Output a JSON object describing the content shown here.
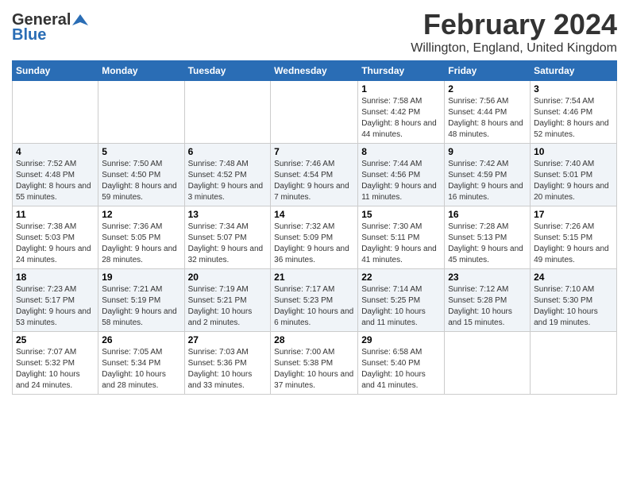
{
  "header": {
    "logo_general": "General",
    "logo_blue": "Blue",
    "month_year": "February 2024",
    "location": "Willington, England, United Kingdom"
  },
  "days_of_week": [
    "Sunday",
    "Monday",
    "Tuesday",
    "Wednesday",
    "Thursday",
    "Friday",
    "Saturday"
  ],
  "weeks": [
    [
      {
        "day": "",
        "sunrise": "",
        "sunset": "",
        "daylight": ""
      },
      {
        "day": "",
        "sunrise": "",
        "sunset": "",
        "daylight": ""
      },
      {
        "day": "",
        "sunrise": "",
        "sunset": "",
        "daylight": ""
      },
      {
        "day": "",
        "sunrise": "",
        "sunset": "",
        "daylight": ""
      },
      {
        "day": "1",
        "sunrise": "Sunrise: 7:58 AM",
        "sunset": "Sunset: 4:42 PM",
        "daylight": "Daylight: 8 hours and 44 minutes."
      },
      {
        "day": "2",
        "sunrise": "Sunrise: 7:56 AM",
        "sunset": "Sunset: 4:44 PM",
        "daylight": "Daylight: 8 hours and 48 minutes."
      },
      {
        "day": "3",
        "sunrise": "Sunrise: 7:54 AM",
        "sunset": "Sunset: 4:46 PM",
        "daylight": "Daylight: 8 hours and 52 minutes."
      }
    ],
    [
      {
        "day": "4",
        "sunrise": "Sunrise: 7:52 AM",
        "sunset": "Sunset: 4:48 PM",
        "daylight": "Daylight: 8 hours and 55 minutes."
      },
      {
        "day": "5",
        "sunrise": "Sunrise: 7:50 AM",
        "sunset": "Sunset: 4:50 PM",
        "daylight": "Daylight: 8 hours and 59 minutes."
      },
      {
        "day": "6",
        "sunrise": "Sunrise: 7:48 AM",
        "sunset": "Sunset: 4:52 PM",
        "daylight": "Daylight: 9 hours and 3 minutes."
      },
      {
        "day": "7",
        "sunrise": "Sunrise: 7:46 AM",
        "sunset": "Sunset: 4:54 PM",
        "daylight": "Daylight: 9 hours and 7 minutes."
      },
      {
        "day": "8",
        "sunrise": "Sunrise: 7:44 AM",
        "sunset": "Sunset: 4:56 PM",
        "daylight": "Daylight: 9 hours and 11 minutes."
      },
      {
        "day": "9",
        "sunrise": "Sunrise: 7:42 AM",
        "sunset": "Sunset: 4:59 PM",
        "daylight": "Daylight: 9 hours and 16 minutes."
      },
      {
        "day": "10",
        "sunrise": "Sunrise: 7:40 AM",
        "sunset": "Sunset: 5:01 PM",
        "daylight": "Daylight: 9 hours and 20 minutes."
      }
    ],
    [
      {
        "day": "11",
        "sunrise": "Sunrise: 7:38 AM",
        "sunset": "Sunset: 5:03 PM",
        "daylight": "Daylight: 9 hours and 24 minutes."
      },
      {
        "day": "12",
        "sunrise": "Sunrise: 7:36 AM",
        "sunset": "Sunset: 5:05 PM",
        "daylight": "Daylight: 9 hours and 28 minutes."
      },
      {
        "day": "13",
        "sunrise": "Sunrise: 7:34 AM",
        "sunset": "Sunset: 5:07 PM",
        "daylight": "Daylight: 9 hours and 32 minutes."
      },
      {
        "day": "14",
        "sunrise": "Sunrise: 7:32 AM",
        "sunset": "Sunset: 5:09 PM",
        "daylight": "Daylight: 9 hours and 36 minutes."
      },
      {
        "day": "15",
        "sunrise": "Sunrise: 7:30 AM",
        "sunset": "Sunset: 5:11 PM",
        "daylight": "Daylight: 9 hours and 41 minutes."
      },
      {
        "day": "16",
        "sunrise": "Sunrise: 7:28 AM",
        "sunset": "Sunset: 5:13 PM",
        "daylight": "Daylight: 9 hours and 45 minutes."
      },
      {
        "day": "17",
        "sunrise": "Sunrise: 7:26 AM",
        "sunset": "Sunset: 5:15 PM",
        "daylight": "Daylight: 9 hours and 49 minutes."
      }
    ],
    [
      {
        "day": "18",
        "sunrise": "Sunrise: 7:23 AM",
        "sunset": "Sunset: 5:17 PM",
        "daylight": "Daylight: 9 hours and 53 minutes."
      },
      {
        "day": "19",
        "sunrise": "Sunrise: 7:21 AM",
        "sunset": "Sunset: 5:19 PM",
        "daylight": "Daylight: 9 hours and 58 minutes."
      },
      {
        "day": "20",
        "sunrise": "Sunrise: 7:19 AM",
        "sunset": "Sunset: 5:21 PM",
        "daylight": "Daylight: 10 hours and 2 minutes."
      },
      {
        "day": "21",
        "sunrise": "Sunrise: 7:17 AM",
        "sunset": "Sunset: 5:23 PM",
        "daylight": "Daylight: 10 hours and 6 minutes."
      },
      {
        "day": "22",
        "sunrise": "Sunrise: 7:14 AM",
        "sunset": "Sunset: 5:25 PM",
        "daylight": "Daylight: 10 hours and 11 minutes."
      },
      {
        "day": "23",
        "sunrise": "Sunrise: 7:12 AM",
        "sunset": "Sunset: 5:28 PM",
        "daylight": "Daylight: 10 hours and 15 minutes."
      },
      {
        "day": "24",
        "sunrise": "Sunrise: 7:10 AM",
        "sunset": "Sunset: 5:30 PM",
        "daylight": "Daylight: 10 hours and 19 minutes."
      }
    ],
    [
      {
        "day": "25",
        "sunrise": "Sunrise: 7:07 AM",
        "sunset": "Sunset: 5:32 PM",
        "daylight": "Daylight: 10 hours and 24 minutes."
      },
      {
        "day": "26",
        "sunrise": "Sunrise: 7:05 AM",
        "sunset": "Sunset: 5:34 PM",
        "daylight": "Daylight: 10 hours and 28 minutes."
      },
      {
        "day": "27",
        "sunrise": "Sunrise: 7:03 AM",
        "sunset": "Sunset: 5:36 PM",
        "daylight": "Daylight: 10 hours and 33 minutes."
      },
      {
        "day": "28",
        "sunrise": "Sunrise: 7:00 AM",
        "sunset": "Sunset: 5:38 PM",
        "daylight": "Daylight: 10 hours and 37 minutes."
      },
      {
        "day": "29",
        "sunrise": "Sunrise: 6:58 AM",
        "sunset": "Sunset: 5:40 PM",
        "daylight": "Daylight: 10 hours and 41 minutes."
      },
      {
        "day": "",
        "sunrise": "",
        "sunset": "",
        "daylight": ""
      },
      {
        "day": "",
        "sunrise": "",
        "sunset": "",
        "daylight": ""
      }
    ]
  ]
}
